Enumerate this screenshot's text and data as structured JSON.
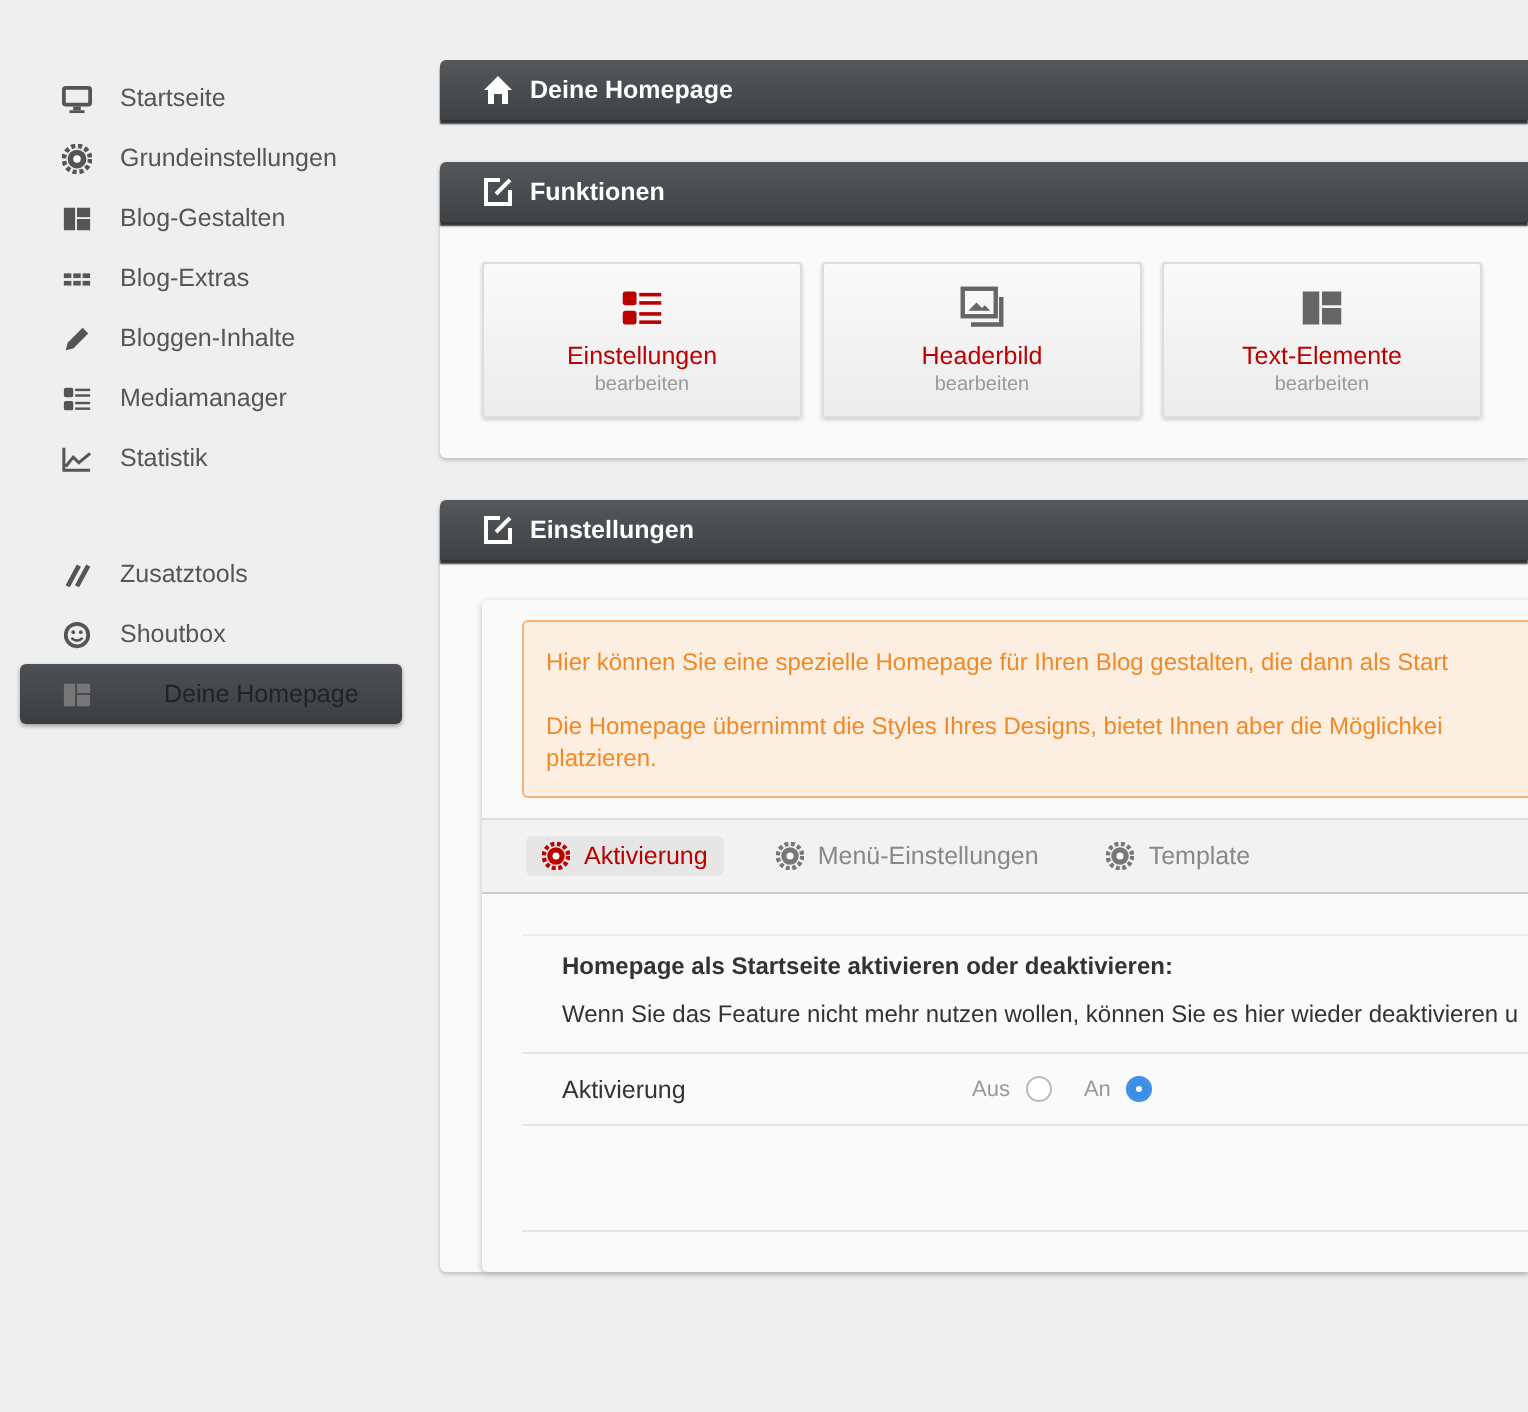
{
  "sidebar": {
    "groups": [
      {
        "items": [
          {
            "label": "Startseite",
            "kind": "monitor",
            "selected": false
          },
          {
            "label": "Grundeinstellungen",
            "kind": "gear",
            "selected": false
          },
          {
            "label": "Blog-Gestalten",
            "kind": "layout",
            "selected": false
          },
          {
            "label": "Blog-Extras",
            "kind": "grid",
            "selected": false
          },
          {
            "label": "Bloggen-Inhalte",
            "kind": "pencil",
            "selected": false
          },
          {
            "label": "Mediamanager",
            "kind": "list",
            "selected": false
          },
          {
            "label": "Statistik",
            "kind": "chart",
            "selected": false
          }
        ]
      },
      {
        "items": [
          {
            "label": "Zusatztools",
            "kind": "tools",
            "selected": false
          },
          {
            "label": "Shoutbox",
            "kind": "smiley",
            "selected": false
          },
          {
            "label": "Deine Homepage",
            "kind": "layout",
            "selected": true
          }
        ]
      }
    ]
  },
  "page_header": {
    "title": "Deine Homepage"
  },
  "functions": {
    "title": "Funktionen",
    "tiles": [
      {
        "kind": "list",
        "title": "Einstellungen",
        "subtitle": "bearbeiten"
      },
      {
        "kind": "image",
        "title": "Headerbild",
        "subtitle": "bearbeiten"
      },
      {
        "kind": "layout",
        "title": "Text-Elemente",
        "subtitle": "bearbeiten"
      }
    ]
  },
  "settings": {
    "title": "Einstellungen",
    "notice": [
      "Hier können Sie eine spezielle Homepage für Ihren Blog gestalten, die dann als Start",
      "Die Homepage übernimmt die Styles Ihres Designs, bietet Ihnen aber die Möglichkei",
      "platzieren."
    ],
    "tabs": [
      {
        "label": "Aktivierung",
        "selected": true
      },
      {
        "label": "Menü-Einstellungen",
        "selected": false
      },
      {
        "label": "Template",
        "selected": false
      }
    ],
    "heading": "Homepage als Startseite aktivieren oder deaktivieren:",
    "description": "Wenn Sie das Feature nicht mehr nutzen wollen, können Sie es hier wieder deaktivieren u",
    "field": {
      "label": "Aktivierung",
      "options": [
        {
          "label": "Aus",
          "selected": false
        },
        {
          "label": "An",
          "selected": true
        }
      ]
    }
  }
}
